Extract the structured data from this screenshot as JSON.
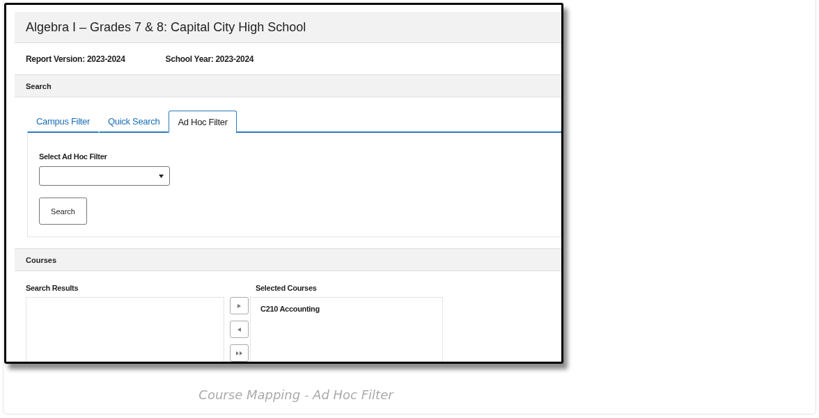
{
  "window": {
    "title": "Algebra I – Grades 7 & 8: Capital City High School"
  },
  "report_info": [
    {
      "label": "Report Version: 2023-2024"
    },
    {
      "label": "School Year: 2023-2024"
    }
  ],
  "search": {
    "header": "Search",
    "tabs": [
      {
        "label": "Campus Filter",
        "selected": false
      },
      {
        "label": "Quick Search",
        "selected": false
      },
      {
        "label": "Ad Hoc Filter",
        "selected": true
      }
    ],
    "filter_label": "Select Ad Hoc Filter",
    "button": "Search"
  },
  "courses": {
    "header": "Courses",
    "search_results_label": "Search Results",
    "selected_label": "Selected Courses",
    "selected_items": [
      "C210 Accounting"
    ]
  },
  "caption": "Course Mapping - Ad Hoc Filter"
}
